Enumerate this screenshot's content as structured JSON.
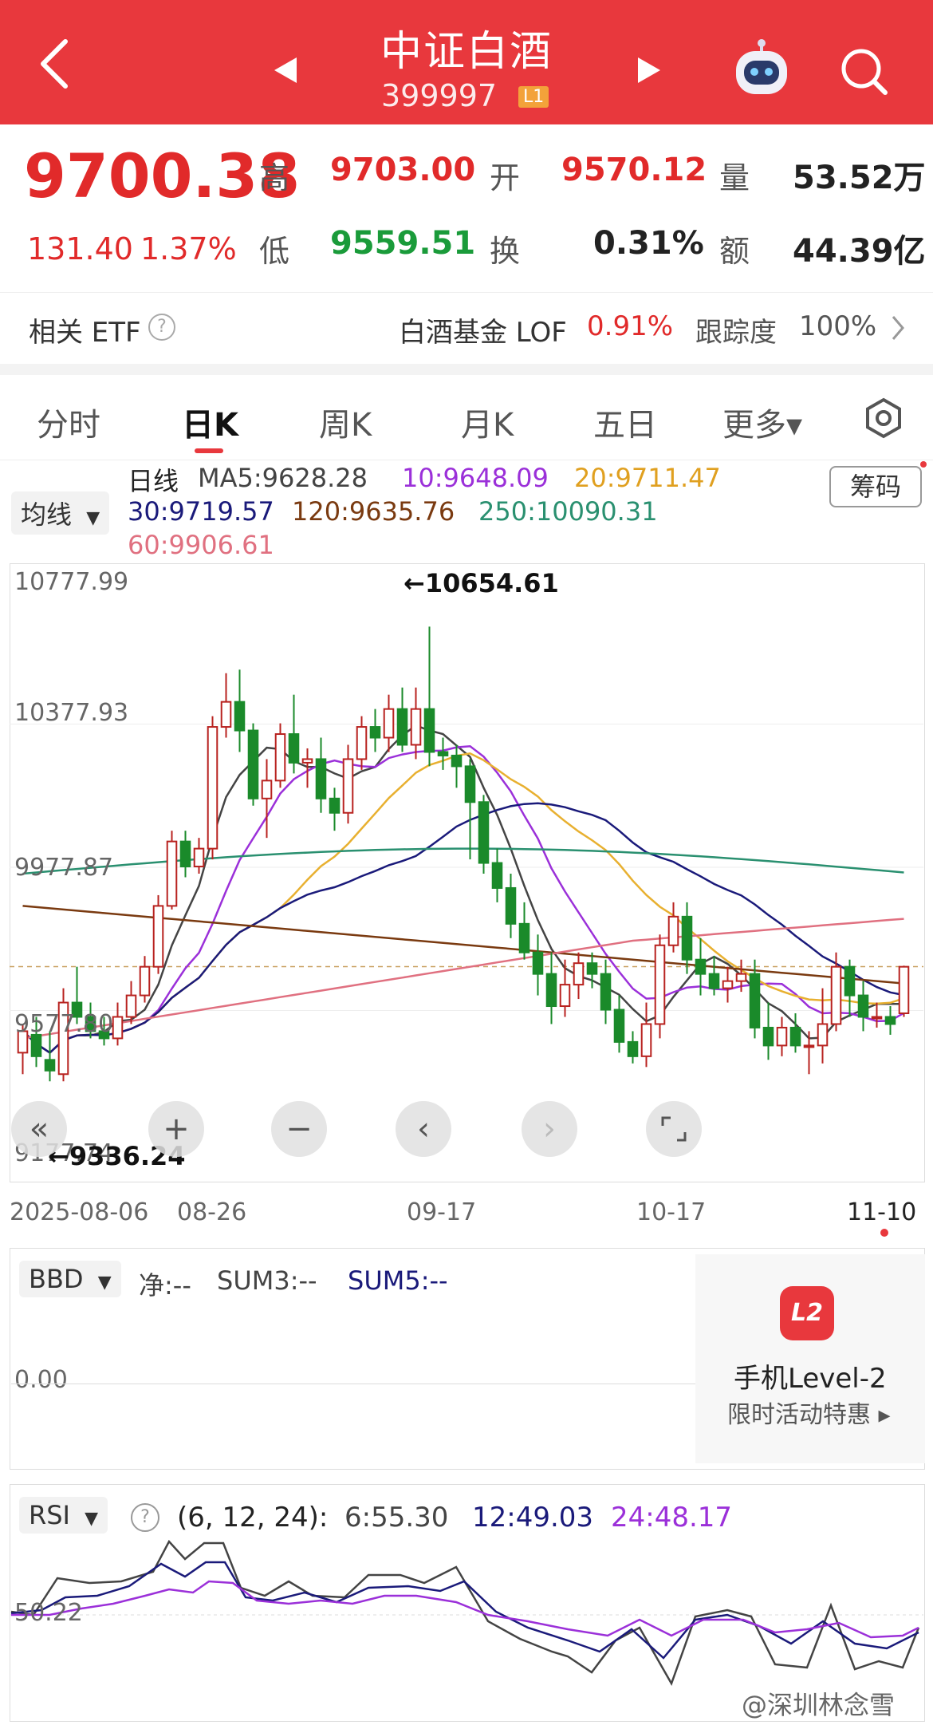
{
  "header": {
    "title": "中证白酒",
    "code": "399997",
    "level_badge": "L1"
  },
  "quote": {
    "price": "9700.38",
    "change": "131.40",
    "change_pct": "1.37%",
    "high_label": "高",
    "high": "9703.00",
    "open_label": "开",
    "open": "9570.12",
    "volume_label": "量",
    "volume": "53.52万",
    "low_label": "低",
    "low": "9559.51",
    "turnover_label": "换",
    "turnover": "0.31%",
    "amount_label": "额",
    "amount": "44.39亿"
  },
  "etf": {
    "label": "相关 ETF",
    "fund_name": "白酒基金 LOF",
    "fund_pct": "0.91%",
    "track_label": "跟踪度",
    "track_value": "100%"
  },
  "tabs": [
    "分时",
    "日K",
    "周K",
    "月K",
    "五日",
    "更多▾"
  ],
  "ma_selector": "均线",
  "chip_button": "筹码",
  "ma_legend": {
    "title": "日线",
    "ma5": "MA5:9628.28",
    "ma10": "10:9648.09",
    "ma20": "20:9711.47",
    "ma30": "30:9719.57",
    "ma120": "120:9635.76",
    "ma250": "250:10090.31",
    "ma60": "60:9906.61"
  },
  "colors": {
    "header_red": "#e8383d",
    "ma5": "#444444",
    "ma10": "#9b30d9",
    "ma20": "#e8b030",
    "ma30": "#1a1a7a",
    "ma60": "#e07080",
    "ma120": "#7a3a10",
    "ma250": "#2a9070",
    "up": "#b8221f",
    "down": "#1a8a2a"
  },
  "chart_data": {
    "type": "candlestick",
    "y_ticks": [
      "10777.99",
      "10377.93",
      "9977.87",
      "9577.80",
      "9177.74"
    ],
    "x_ticks": [
      "2025-08-06",
      "08-26",
      "09-17",
      "10-17",
      "11-10"
    ],
    "annotations": {
      "max": "←10654.61",
      "min": "←9336.24"
    },
    "ylim": [
      9177.74,
      10777.99
    ],
    "candles": [
      [
        9460,
        9520,
        9400,
        9540
      ],
      [
        9510,
        9450,
        9420,
        9560
      ],
      [
        9440,
        9410,
        9380,
        9520
      ],
      [
        9400,
        9600,
        9380,
        9640
      ],
      [
        9600,
        9560,
        9540,
        9700
      ],
      [
        9560,
        9520,
        9500,
        9600
      ],
      [
        9520,
        9500,
        9480,
        9560
      ],
      [
        9500,
        9560,
        9480,
        9600
      ],
      [
        9560,
        9620,
        9540,
        9660
      ],
      [
        9620,
        9700,
        9600,
        9730
      ],
      [
        9700,
        9870,
        9680,
        9900
      ],
      [
        9870,
        10050,
        9860,
        10080
      ],
      [
        10050,
        9980,
        9950,
        10080
      ],
      [
        9980,
        10030,
        9960,
        10060
      ],
      [
        10030,
        10370,
        10000,
        10400
      ],
      [
        10370,
        10440,
        10340,
        10520
      ],
      [
        10440,
        10360,
        10300,
        10530
      ],
      [
        10360,
        10170,
        10150,
        10380
      ],
      [
        10170,
        10220,
        10060,
        10280
      ],
      [
        10220,
        10350,
        10200,
        10380
      ],
      [
        10350,
        10270,
        10240,
        10460
      ],
      [
        10270,
        10280,
        10200,
        10310
      ],
      [
        10280,
        10170,
        10130,
        10340
      ],
      [
        10170,
        10130,
        10080,
        10200
      ],
      [
        10130,
        10280,
        10100,
        10320
      ],
      [
        10280,
        10370,
        10250,
        10400
      ],
      [
        10370,
        10340,
        10300,
        10420
      ],
      [
        10340,
        10420,
        10300,
        10460
      ],
      [
        10420,
        10320,
        10300,
        10480
      ],
      [
        10320,
        10420,
        10280,
        10480
      ],
      [
        10420,
        10300,
        10260,
        10650
      ],
      [
        10300,
        10290,
        10250,
        10340
      ],
      [
        10290,
        10260,
        10200,
        10320
      ],
      [
        10260,
        10160,
        10000,
        10280
      ],
      [
        10160,
        9990,
        9960,
        10180
      ],
      [
        9990,
        9920,
        9880,
        10030
      ],
      [
        9920,
        9820,
        9780,
        9960
      ],
      [
        9820,
        9740,
        9720,
        9880
      ],
      [
        9740,
        9680,
        9620,
        9790
      ],
      [
        9680,
        9590,
        9540,
        9740
      ],
      [
        9590,
        9650,
        9560,
        9720
      ],
      [
        9650,
        9710,
        9610,
        9740
      ],
      [
        9710,
        9680,
        9640,
        9740
      ],
      [
        9680,
        9580,
        9540,
        9720
      ],
      [
        9580,
        9490,
        9460,
        9620
      ],
      [
        9490,
        9450,
        9430,
        9520
      ],
      [
        9450,
        9540,
        9420,
        9600
      ],
      [
        9540,
        9760,
        9500,
        9790
      ],
      [
        9760,
        9840,
        9740,
        9880
      ],
      [
        9840,
        9720,
        9680,
        9880
      ],
      [
        9720,
        9680,
        9620,
        9780
      ],
      [
        9680,
        9640,
        9620,
        9730
      ],
      [
        9640,
        9660,
        9600,
        9700
      ],
      [
        9660,
        9680,
        9630,
        9720
      ],
      [
        9680,
        9530,
        9500,
        9720
      ],
      [
        9530,
        9480,
        9440,
        9600
      ],
      [
        9480,
        9530,
        9450,
        9560
      ],
      [
        9530,
        9480,
        9460,
        9570
      ],
      [
        9480,
        9480,
        9400,
        9520
      ],
      [
        9480,
        9540,
        9430,
        9640
      ],
      [
        9540,
        9700,
        9520,
        9740
      ],
      [
        9700,
        9620,
        9560,
        9720
      ],
      [
        9620,
        9560,
        9520,
        9660
      ],
      [
        9560,
        9560,
        9530,
        9600
      ],
      [
        9560,
        9540,
        9510,
        9590
      ],
      [
        9570,
        9700,
        9560,
        9703
      ]
    ]
  },
  "bbd": {
    "selector": "BBD",
    "net": "净:--",
    "sum3": "SUM3:--",
    "sum5": "SUM5:--",
    "zero": "0.00"
  },
  "promo": {
    "badge": "L2",
    "title": "手机Level-2",
    "subtitle": "限时活动特惠 ▸"
  },
  "rsi": {
    "selector": "RSI",
    "params": "(6, 12, 24):",
    "rsi6": "6:55.30",
    "rsi12": "12:49.03",
    "rsi24": "24:48.17",
    "mid": "50.22"
  },
  "watermark": "@深圳林念雪"
}
